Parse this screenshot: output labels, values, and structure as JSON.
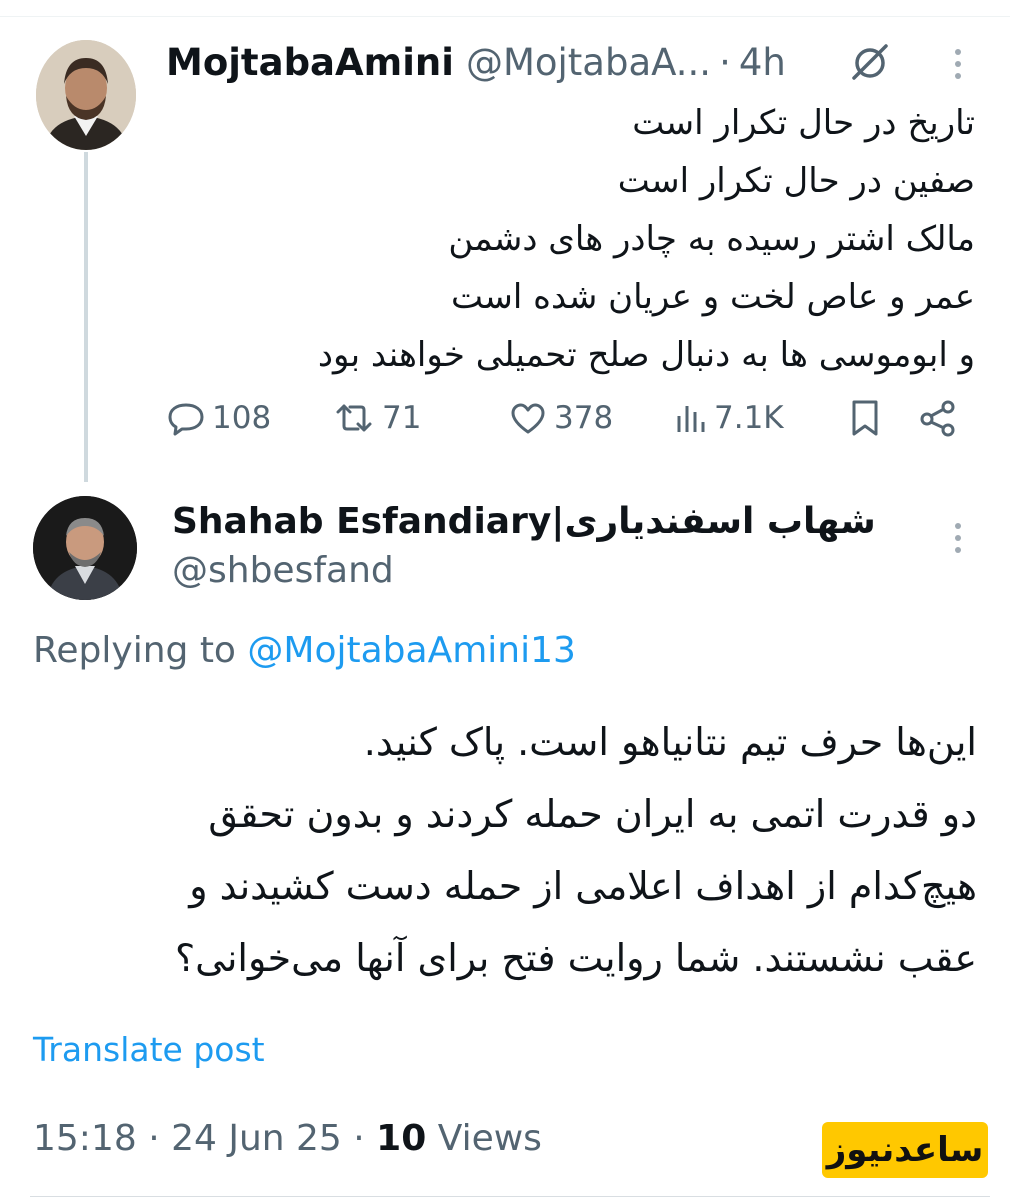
{
  "parent_tweet": {
    "name": "MojtabaAmini",
    "handle": "@MojtabaA...",
    "separator": "·",
    "time": "4h",
    "icon": "grok-icon",
    "lines": [
      "تاریخ در حال تکرار است",
      "صفین در حال تکرار است",
      "مالک اشتر رسیده به چادر های دشمن",
      "عمر و عاص لخت و عریان شده است",
      "و ابوموسی ها به دنبال صلح تحمیلی خواهند بود"
    ],
    "stats": {
      "replies": "108",
      "reposts": "71",
      "likes": "378",
      "views": "7.1K"
    }
  },
  "reply_tweet": {
    "name": "Shahab Esfandiary|شهاب اسفندیاری",
    "handle": "@shbesfand",
    "replying_prefix": "Replying to",
    "replying_to": "@MojtabaAmini13",
    "lines": [
      "این‌ها حرف تیم نتانیاهو است. پاک کنید.",
      "دو قدرت اتمی به ایران حمله کردند و بدون تحقق",
      "هیچ‌کدام از اهداف اعلامی از حمله دست کشیدند و",
      "عقب نشستند. شما روایت فتح برای آنها می‌خوانی؟"
    ],
    "translate_label": "Translate post",
    "timestamp": "15:18 · 24 Jun 25 ·",
    "views_count": "10",
    "views_label": "Views"
  },
  "watermark": "ساعدنیوز",
  "colors": {
    "text": "#0f1419",
    "secondary": "#536471",
    "link": "#1d9bf0",
    "watermark_bg": "#ffc800"
  }
}
